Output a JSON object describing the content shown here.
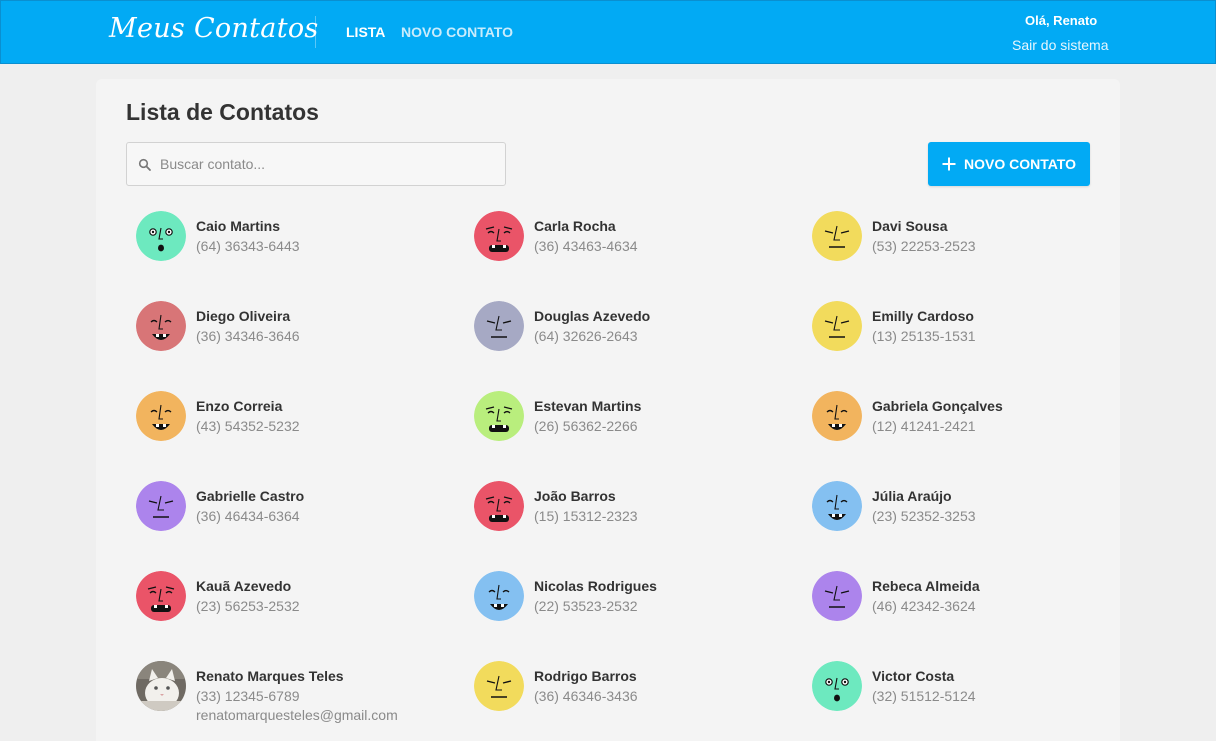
{
  "header": {
    "brand": "Meus Contatos",
    "nav": [
      {
        "label": "LISTA"
      },
      {
        "label": "NOVO CONTATO"
      }
    ],
    "greeting": "Olá, Renato",
    "logout": "Sair do sistema"
  },
  "main": {
    "title": "Lista de Contatos",
    "search": {
      "placeholder": "Buscar contato...",
      "value": ""
    },
    "new_button": "NOVO CONTATO"
  },
  "colors": {
    "primary": "#02aaf4",
    "avatars": {
      "mint": "#6de9bf",
      "red": "#ea5468",
      "yellow": "#f2db5c",
      "rose": "#d87577",
      "slate": "#a6a9c4",
      "orange": "#f2b45e",
      "lime": "#b9ee7d",
      "purple": "#ac84ec",
      "blue": "#84c0f1"
    }
  },
  "contacts": [
    {
      "name": "Caio Martins",
      "phone": "(64) 36343-6443",
      "avatar": "mint-face-icon",
      "color": "#6de9bf"
    },
    {
      "name": "Carla Rocha",
      "phone": "(36) 43463-4634",
      "avatar": "red-face-icon",
      "color": "#ea5468"
    },
    {
      "name": "Davi Sousa",
      "phone": "(53) 22253-2523",
      "avatar": "yellow-face-icon",
      "color": "#f2db5c"
    },
    {
      "name": "Diego Oliveira",
      "phone": "(36) 34346-3646",
      "avatar": "rose-face-icon",
      "color": "#d87577"
    },
    {
      "name": "Douglas Azevedo",
      "phone": "(64) 32626-2643",
      "avatar": "slate-face-icon",
      "color": "#a6a9c4"
    },
    {
      "name": "Emilly Cardoso",
      "phone": "(13) 25135-1531",
      "avatar": "yellow-face-icon",
      "color": "#f2db5c"
    },
    {
      "name": "Enzo Correia",
      "phone": "(43) 54352-5232",
      "avatar": "orange-face-icon",
      "color": "#f2b45e"
    },
    {
      "name": "Estevan Martins",
      "phone": "(26) 56362-2266",
      "avatar": "lime-face-icon",
      "color": "#b9ee7d"
    },
    {
      "name": "Gabriela Gonçalves",
      "phone": "(12) 41241-2421",
      "avatar": "orange-face-icon",
      "color": "#f2b45e"
    },
    {
      "name": "Gabrielle Castro",
      "phone": "(36) 46434-6364",
      "avatar": "purple-face-icon",
      "color": "#ac84ec"
    },
    {
      "name": "João Barros",
      "phone": "(15) 15312-2323",
      "avatar": "red-face-icon",
      "color": "#ea5468"
    },
    {
      "name": "Júlia Araújo",
      "phone": "(23) 52352-3253",
      "avatar": "blue-face-icon",
      "color": "#84c0f1"
    },
    {
      "name": "Kauã Azevedo",
      "phone": "(23) 56253-2532",
      "avatar": "red-face-icon",
      "color": "#ea5468"
    },
    {
      "name": "Nicolas Rodrigues",
      "phone": "(22) 53523-2532",
      "avatar": "blue-face-icon",
      "color": "#84c0f1"
    },
    {
      "name": "Rebeca Almeida",
      "phone": "(46) 42342-3624",
      "avatar": "purple-face-icon",
      "color": "#ac84ec"
    },
    {
      "name": "Renato Marques Teles",
      "phone": "(33) 12345-6789",
      "email": "renatomarquesteles@gmail.com",
      "avatar": "cat-photo-avatar",
      "color": "#d9d6d2"
    },
    {
      "name": "Rodrigo Barros",
      "phone": "(36) 46346-3436",
      "avatar": "yellow-face-icon",
      "color": "#f2db5c"
    },
    {
      "name": "Victor Costa",
      "phone": "(32) 51512-5124",
      "avatar": "mint-face-icon",
      "color": "#6de9bf"
    }
  ]
}
